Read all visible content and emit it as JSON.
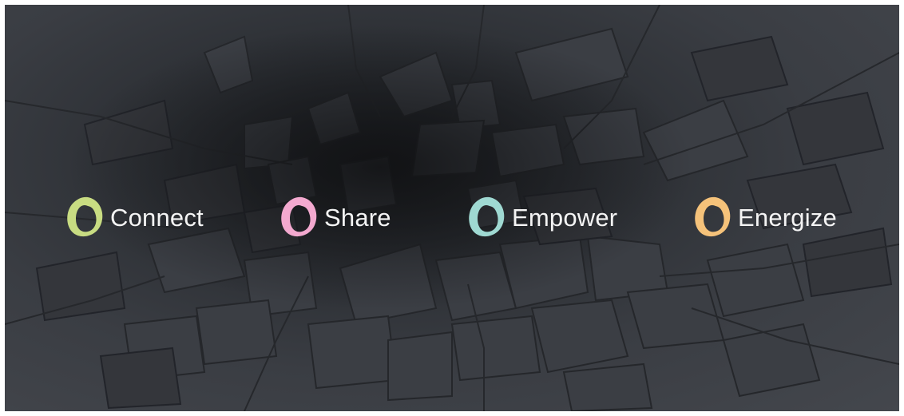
{
  "banner": {
    "background": "dark cracked stone wall",
    "items": [
      {
        "label": "Connect",
        "icon": "ring-icon",
        "color": "#c8dc82"
      },
      {
        "label": "Share",
        "icon": "ring-icon",
        "color": "#f3a9cf"
      },
      {
        "label": "Empower",
        "icon": "ring-icon",
        "color": "#9fd9d2"
      },
      {
        "label": "Energize",
        "icon": "ring-icon",
        "color": "#f5c27a"
      }
    ]
  }
}
